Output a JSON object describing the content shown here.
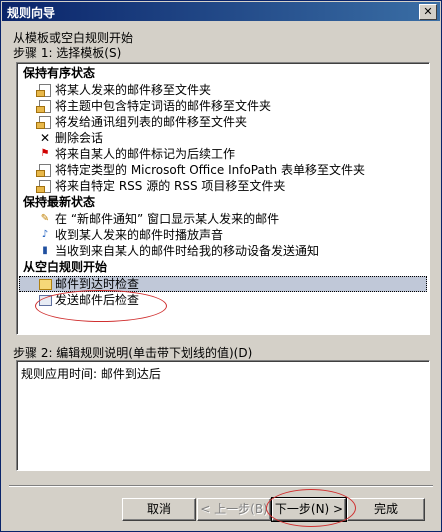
{
  "window": {
    "title": "规则向导",
    "close_label": "✕"
  },
  "intro": "从模板或空白规则开始",
  "step1_label": "步骤 1: 选择模板(S)",
  "groups": [
    {
      "title": "保持有序状态",
      "items": [
        {
          "icon": "doc-move-icon",
          "label": "将某人发来的邮件移至文件夹"
        },
        {
          "icon": "doc-move-icon",
          "label": "将主题中包含特定词语的邮件移至文件夹"
        },
        {
          "icon": "doc-move-icon",
          "label": "将发给通讯组列表的邮件移至文件夹"
        },
        {
          "icon": "delete-x-icon",
          "label": "删除会话"
        },
        {
          "icon": "red-flag-icon",
          "label": "将来自某人的邮件标记为后续工作"
        },
        {
          "icon": "doc-move-icon",
          "label": "将特定类型的 Microsoft Office InfoPath 表单移至文件夹"
        },
        {
          "icon": "doc-move-icon",
          "label": "将来自特定 RSS 源的 RSS 项目移至文件夹"
        }
      ]
    },
    {
      "title": "保持最新状态",
      "items": [
        {
          "icon": "note-alert-icon",
          "label": "在 “新邮件通知” 窗口显示某人发来的邮件"
        },
        {
          "icon": "sound-icon",
          "label": "收到某人发来的邮件时播放声音"
        },
        {
          "icon": "mobile-phone-icon",
          "label": "当收到来自某人的邮件时给我的移动设备发送通知"
        }
      ]
    },
    {
      "title": "从空白规则开始",
      "items": [
        {
          "icon": "envelope-icon",
          "label": "邮件到达时检查",
          "selected": true
        },
        {
          "icon": "send-mail-icon",
          "label": "发送邮件后检查"
        }
      ]
    }
  ],
  "step2_label": "步骤 2: 编辑规则说明(单击带下划线的值)(D)",
  "rule_description": "规则应用时间: 邮件到达后",
  "buttons": {
    "cancel": "取消",
    "back": "< 上一步(B)",
    "next": "下一步(N) >",
    "finish": "完成"
  }
}
